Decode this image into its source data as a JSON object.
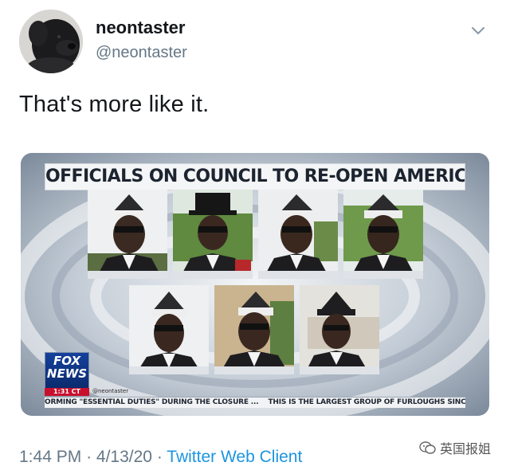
{
  "user": {
    "display_name": "neontaster",
    "handle": "@neontaster",
    "avatar_icon": "black-dog-avatar"
  },
  "menu_icon": "chevron-down-icon",
  "tweet": {
    "text": "That's more like it."
  },
  "media": {
    "headline": "OFFICIALS ON COUNCIL TO RE-OPEN AMERICA",
    "network_logo_line1": "FOX",
    "network_logo_line2": "NEWS",
    "clock": "1:31 CT",
    "credit": "@neontaster",
    "ticker_left": "ORMING \"ESSENTIAL DUTIES\" DURING THE CLOSURE ...",
    "ticker_right": "THIS IS THE LARGEST GROUP OF FURLOUGHS SINC",
    "accent_red": "#c8102e",
    "fox_blue": "#14419c"
  },
  "footer": {
    "time": "1:44 PM",
    "separator": "·",
    "date": "4/13/20",
    "client": "Twitter Web Client"
  },
  "watermark": {
    "text": "英国报姐",
    "icon": "wechat-icon"
  }
}
